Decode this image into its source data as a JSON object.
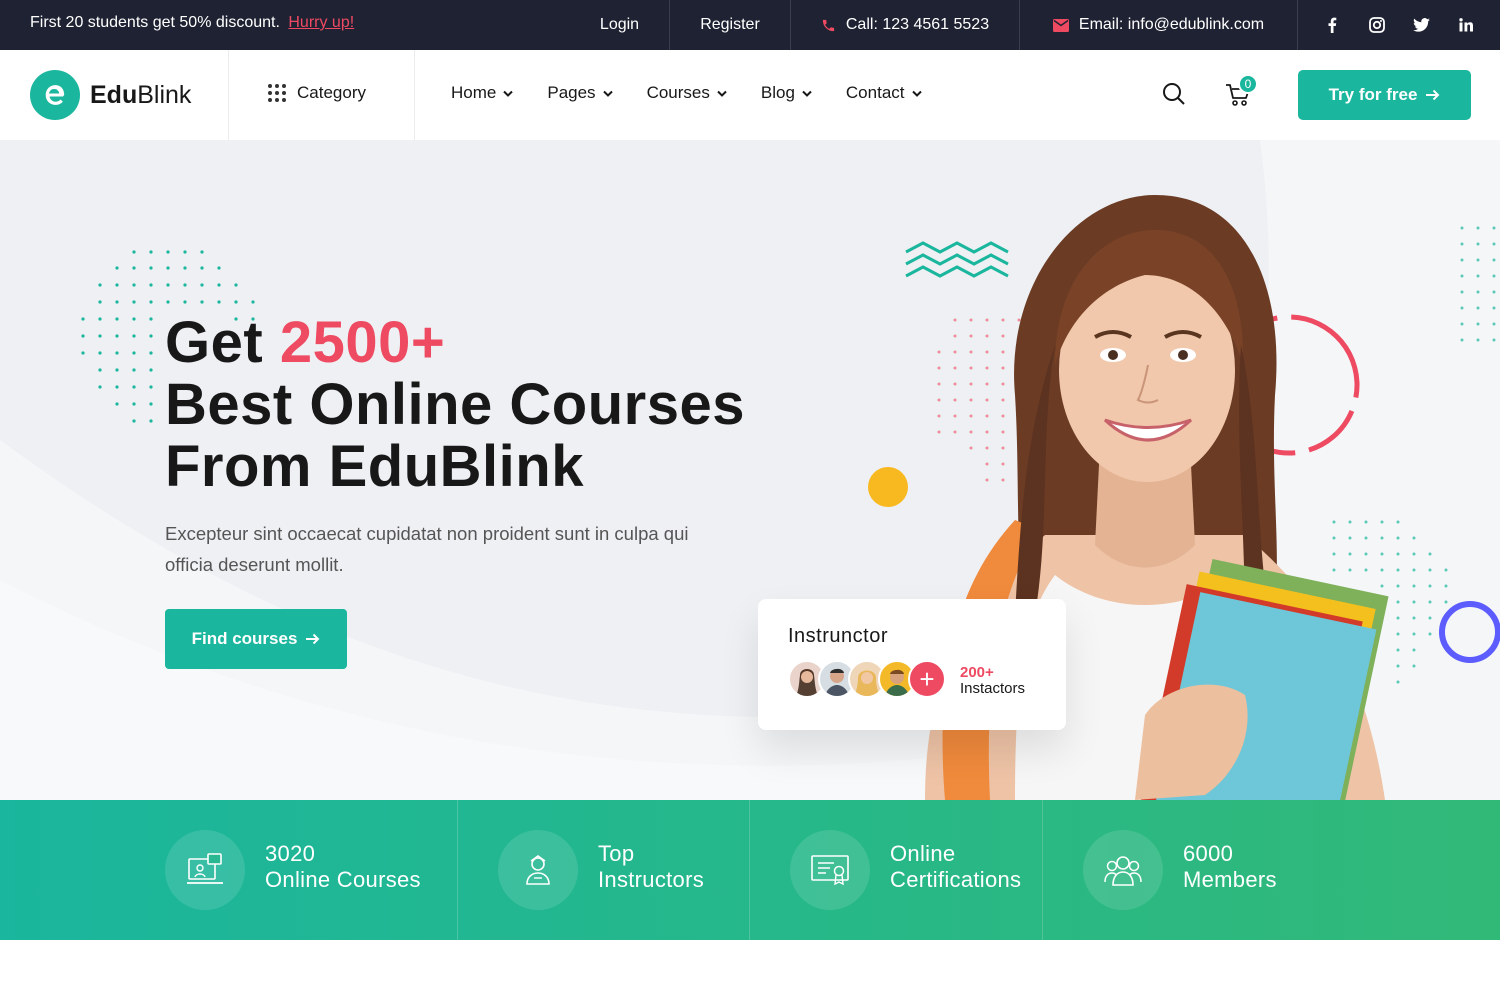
{
  "topbar": {
    "promo_text": "First 20 students get 50% discount.",
    "promo_link": "Hurry up!",
    "login": "Login",
    "register": "Register",
    "call": "Call: 123 4561 5523",
    "email": "Email: info@edublink.com",
    "social_icons": [
      "facebook-icon",
      "instagram-icon",
      "twitter-icon",
      "linkedin-icon"
    ]
  },
  "header": {
    "logo_bold": "Edu",
    "logo_light": "Blink",
    "category": "Category",
    "nav": [
      "Home",
      "Pages",
      "Courses",
      "Blog",
      "Contact"
    ],
    "cart_count": "0",
    "try_button": "Try for free"
  },
  "hero": {
    "title_prefix": "Get",
    "title_accent": "2500+",
    "title_line2": "Best Online Courses",
    "title_line3": "From EduBlink",
    "description": "Excepteur sint occaecat cupidatat non proident sunt in culpa qui officia deserunt mollit.",
    "cta": "Find courses"
  },
  "instructor_card": {
    "title": "Instrunctor",
    "count": "200+",
    "label": "Instactors"
  },
  "features": [
    {
      "line1": "3020",
      "line2": "Online Courses",
      "icon": "laptop-icon"
    },
    {
      "line1": "Top",
      "line2": "Instructors",
      "icon": "instructor-icon"
    },
    {
      "line1": "Online",
      "line2": "Certifications",
      "icon": "certificate-icon"
    },
    {
      "line1": "6000",
      "line2": "Members",
      "icon": "members-icon"
    }
  ],
  "colors": {
    "primary": "#1ab69d",
    "accent": "#ee4a62",
    "dark": "#1f2232",
    "yellow": "#f8b81f",
    "purple": "#5d5cff"
  }
}
